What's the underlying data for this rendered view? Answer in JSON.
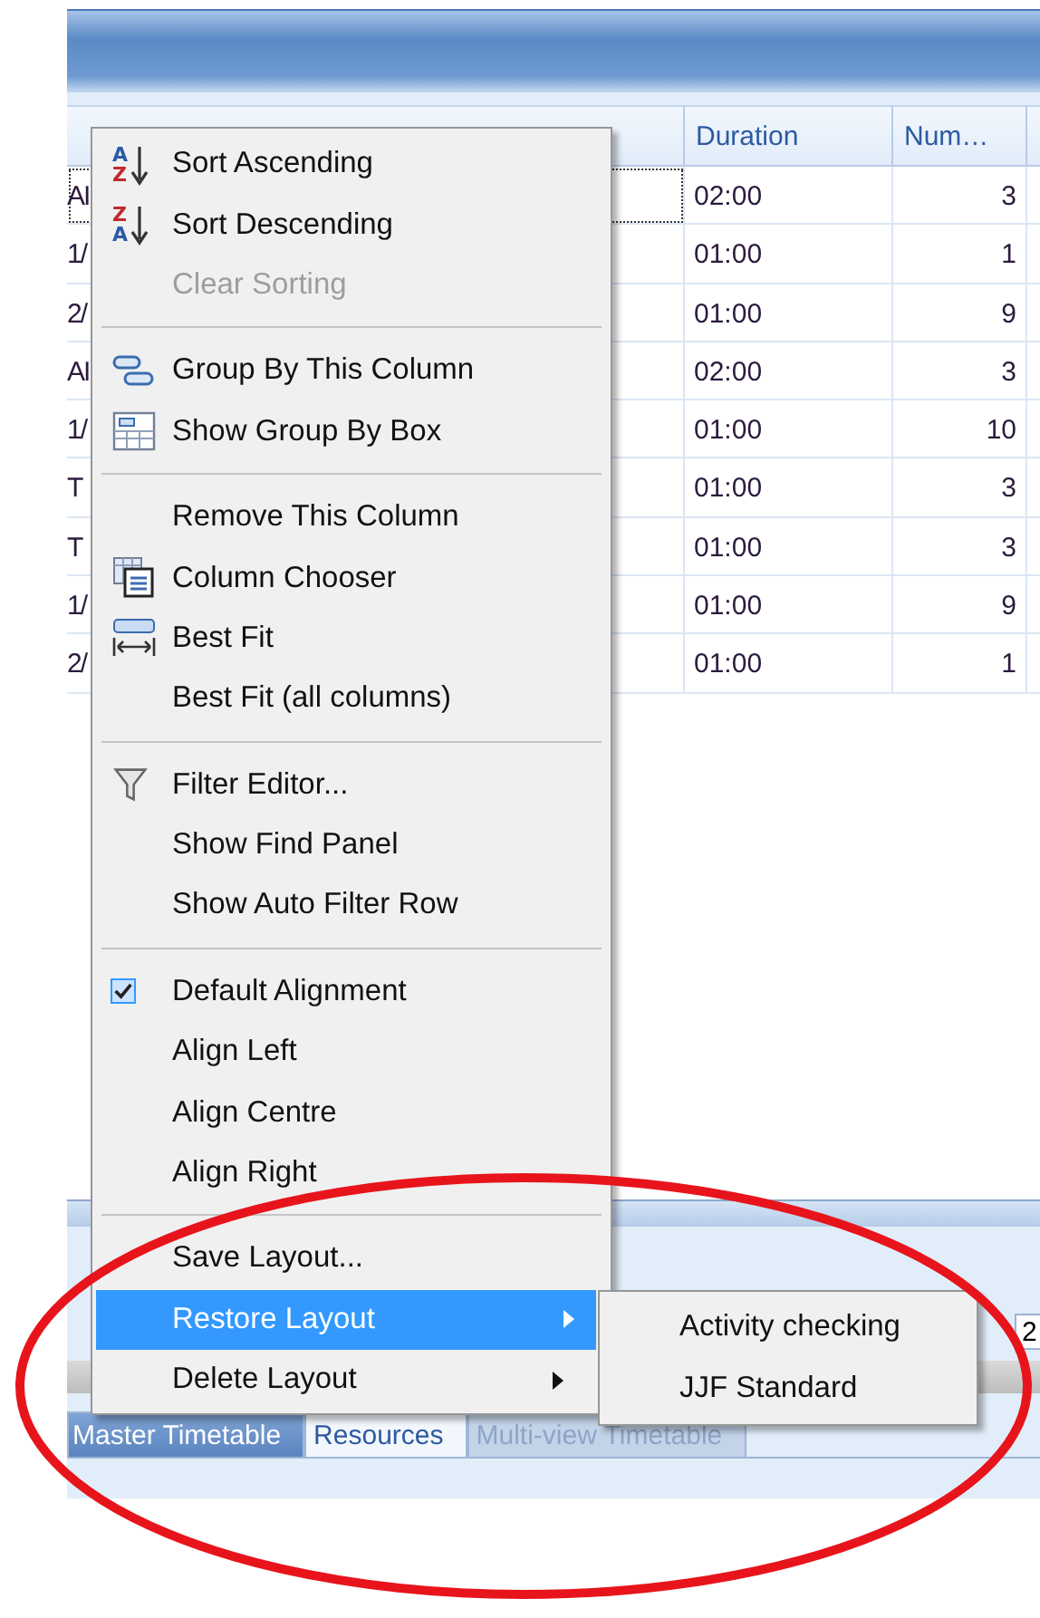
{
  "grid": {
    "columns": [
      {},
      {
        "label": "Duration"
      },
      {
        "label": "Num…"
      }
    ],
    "rows": [
      [
        "AI",
        "02:00",
        "3"
      ],
      [
        "1/",
        "01:00",
        "1"
      ],
      [
        "2/",
        "01:00",
        "9"
      ],
      [
        "AI",
        "02:00",
        "3"
      ],
      [
        "1/",
        "01:00",
        "10"
      ],
      [
        "T",
        "01:00",
        "3"
      ],
      [
        "T",
        "01:00",
        "3"
      ],
      [
        "1/",
        "01:00",
        "9"
      ],
      [
        "2/",
        "01:00",
        "1"
      ]
    ]
  },
  "field": {
    "value": "2"
  },
  "tabs": [
    {
      "label": "Master Timetable",
      "selected": false,
      "disabled": false
    },
    {
      "label": "Resources",
      "selected": true,
      "disabled": false
    },
    {
      "label": "Multi-view Timetable",
      "selected": false,
      "disabled": true
    }
  ],
  "context_menu": {
    "groups": [
      [
        {
          "label": "Sort Ascending",
          "kind": "sort",
          "icon_letters": [
            "A",
            "Z"
          ],
          "disabled": false,
          "checked": false,
          "selected": false,
          "submenu": false
        },
        {
          "label": "Sort Descending",
          "kind": "sort",
          "icon_letters": [
            "Z",
            "A"
          ],
          "disabled": false,
          "checked": false,
          "selected": false,
          "submenu": false
        },
        {
          "label": "Clear Sorting",
          "kind": "plain",
          "disabled": true,
          "checked": false,
          "selected": false,
          "submenu": false
        }
      ],
      [
        {
          "label": "Group By This Column",
          "kind": "group",
          "disabled": false,
          "checked": false,
          "selected": false,
          "submenu": false
        },
        {
          "label": "Show Group By Box",
          "kind": "groupbox",
          "disabled": false,
          "checked": false,
          "selected": false,
          "submenu": false
        }
      ],
      [
        {
          "label": "Remove This Column",
          "kind": "plain",
          "disabled": false,
          "checked": false,
          "selected": false,
          "submenu": false
        },
        {
          "label": "Column Chooser",
          "kind": "chooser",
          "disabled": false,
          "checked": false,
          "selected": false,
          "submenu": false
        },
        {
          "label": "Best Fit",
          "kind": "bestfit",
          "disabled": false,
          "checked": false,
          "selected": false,
          "submenu": false
        },
        {
          "label": "Best Fit (all columns)",
          "kind": "plain",
          "disabled": false,
          "checked": false,
          "selected": false,
          "submenu": false
        }
      ],
      [
        {
          "label": "Filter Editor...",
          "kind": "filter",
          "disabled": false,
          "checked": false,
          "selected": false,
          "submenu": false
        },
        {
          "label": "Show Find Panel",
          "kind": "plain",
          "disabled": false,
          "checked": false,
          "selected": false,
          "submenu": false
        },
        {
          "label": "Show Auto Filter Row",
          "kind": "plain",
          "disabled": false,
          "checked": false,
          "selected": false,
          "submenu": false
        }
      ],
      [
        {
          "label": "Default Alignment",
          "kind": "plain",
          "disabled": false,
          "checked": true,
          "selected": false,
          "submenu": false
        },
        {
          "label": "Align Left",
          "kind": "plain",
          "disabled": false,
          "checked": false,
          "selected": false,
          "submenu": false
        },
        {
          "label": "Align Centre",
          "kind": "plain",
          "disabled": false,
          "checked": false,
          "selected": false,
          "submenu": false
        },
        {
          "label": "Align Right",
          "kind": "plain",
          "disabled": false,
          "checked": false,
          "selected": false,
          "submenu": false
        }
      ],
      [
        {
          "label": "Save Layout...",
          "kind": "plain",
          "disabled": false,
          "checked": false,
          "selected": false,
          "submenu": false
        },
        {
          "label": "Restore Layout",
          "kind": "plain",
          "disabled": false,
          "checked": false,
          "selected": true,
          "submenu": true
        },
        {
          "label": "Delete Layout",
          "kind": "plain",
          "disabled": false,
          "checked": false,
          "selected": false,
          "submenu": true
        }
      ]
    ]
  },
  "submenu": {
    "items": [
      {
        "label": "Activity checking"
      },
      {
        "label": "JJF Standard"
      }
    ]
  }
}
